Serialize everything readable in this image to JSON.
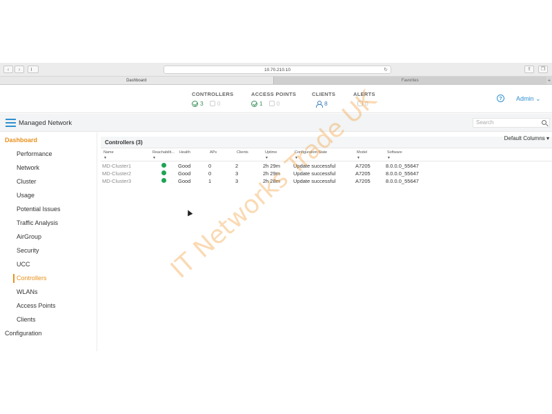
{
  "browser": {
    "url": "10.70.210.10",
    "tabs": [
      "Dashboard",
      "Favorites"
    ],
    "tab_add": "+"
  },
  "summary": {
    "controllers": {
      "title": "CONTROLLERS",
      "ok": "3",
      "other": "0"
    },
    "access_points": {
      "title": "ACCESS POINTS",
      "ok": "1",
      "other": "0"
    },
    "clients": {
      "title": "CLIENTS",
      "value": "8"
    },
    "alerts": {
      "title": "ALERTS",
      "value": "0"
    },
    "help": "?",
    "admin": "Admin ⌄"
  },
  "topbar": {
    "title": "Managed Network",
    "search_placeholder": "Search"
  },
  "sidebar": {
    "header": "Dashboard",
    "items": [
      "Performance",
      "Network",
      "Cluster",
      "Usage",
      "Potential Issues",
      "Traffic Analysis",
      "AirGroup",
      "Security",
      "UCC",
      "Controllers",
      "WLANs",
      "Access Points",
      "Clients"
    ],
    "active": "Controllers",
    "bottom": "Configuration"
  },
  "main": {
    "default_columns": "Default Columns ▾",
    "panel_title": "Controllers (3)",
    "columns": [
      "Name",
      "Reachabilit...",
      "Health",
      "APs",
      "Clients",
      "Uptime",
      "Configuration State",
      "Model",
      "Software"
    ],
    "rows": [
      {
        "name": "MD-Cluster1",
        "reach": "up",
        "health": "Good",
        "aps": "0",
        "clients": "2",
        "uptime": "2h 29m",
        "config": "Update successful",
        "model": "A7205",
        "software": "8.0.0.0_55647"
      },
      {
        "name": "MD-Cluster2",
        "reach": "up",
        "health": "Good",
        "aps": "0",
        "clients": "3",
        "uptime": "2h 29m",
        "config": "Update successful",
        "model": "A7205",
        "software": "8.0.0.0_55647"
      },
      {
        "name": "MD-Cluster3",
        "reach": "up",
        "health": "Good",
        "aps": "1",
        "clients": "3",
        "uptime": "2h 28m",
        "config": "Update successful",
        "model": "A7205",
        "software": "8.0.0.0_55647"
      }
    ]
  },
  "watermark": "IT Networks Trade UK",
  "colors": {
    "accent_orange": "#e8911c",
    "accent_blue": "#2d8fd0",
    "status_green": "#1fa355"
  }
}
